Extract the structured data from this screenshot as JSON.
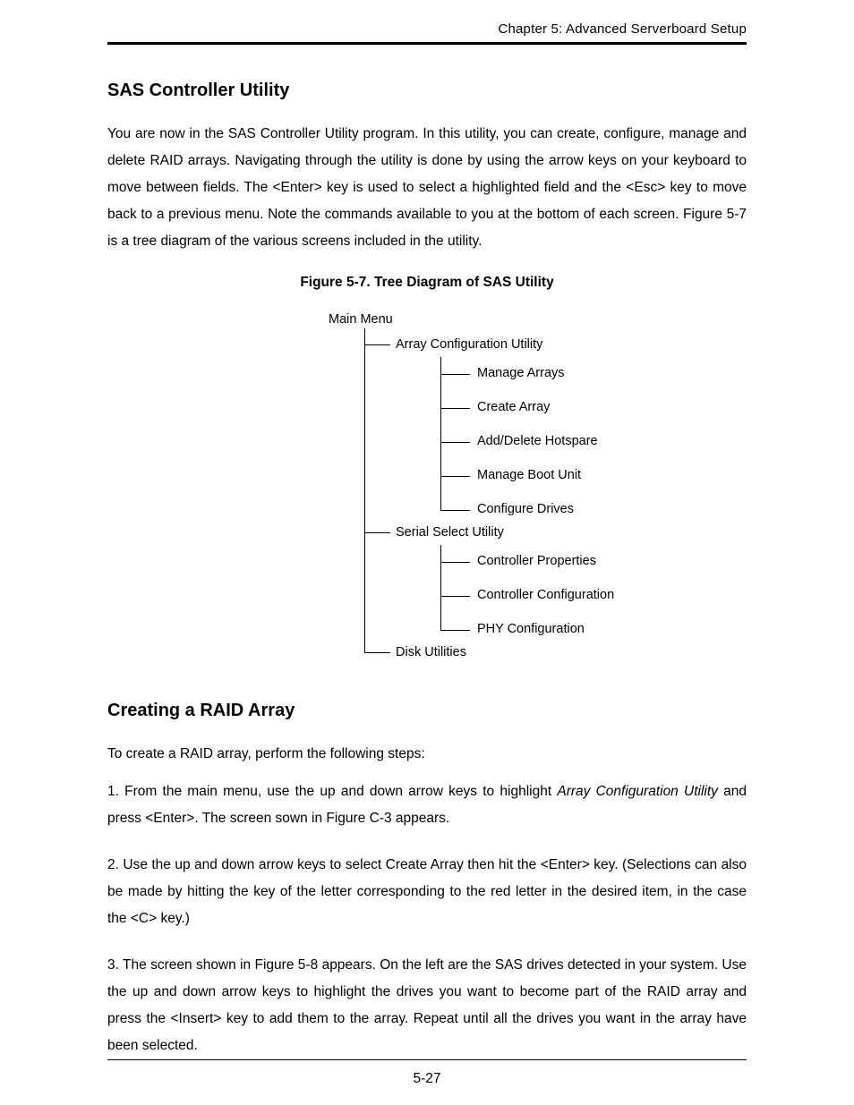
{
  "header": {
    "running": "Chapter 5: Advanced Serverboard Setup"
  },
  "section1": {
    "title": "SAS Controller Utility",
    "para": "You are now in the SAS Controller Utility program.  In this utility, you can create, configure, manage and delete RAID arrays.  Navigating through the utility is done by using the arrow keys on your keyboard to move between fields.  The <Enter> key is used to select a highlighted field and the <Esc> key to move back to a previous menu.  Note the commands available to you at the bottom of each screen.  Figure 5-7 is a tree diagram of the various screens included in the utility."
  },
  "figure": {
    "caption": "Figure 5-7. Tree Diagram of SAS Utility",
    "tree": {
      "root": "Main Menu",
      "branches": [
        {
          "label": "Array Configuration Utility",
          "children": [
            "Manage Arrays",
            "Create Array",
            "Add/Delete Hotspare",
            "Manage Boot Unit",
            "Configure Drives"
          ]
        },
        {
          "label": "Serial Select Utility",
          "children": [
            "Controller Properties",
            "Controller Configuration",
            "PHY Configuration"
          ]
        },
        {
          "label": "Disk Utilities",
          "children": []
        }
      ]
    }
  },
  "section2": {
    "title": "Creating a RAID Array",
    "intro": "To create a RAID array, perform the following steps:",
    "step1_a": "1. From the main menu, use the up and down arrow keys to highlight ",
    "step1_it": "Array Configuration Utility",
    "step1_b": " and press <Enter>.  The screen sown in Figure C-3 appears.",
    "step2": "2. Use the up and down arrow keys to select Create Array then hit the <Enter> key.  (Selections can also be made by hitting the key of the letter corresponding to the red letter in the desired item, in the case the <C> key.)",
    "step3": "3. The screen shown in Figure 5-8 appears.  On the left are the SAS drives detected in your system.  Use the up and down arrow keys to highlight the drives you want to become part of the RAID array and press the <Insert> key to add them to the array.  Repeat until all the drives you want in the array have been selected."
  },
  "page_number": "5-27"
}
